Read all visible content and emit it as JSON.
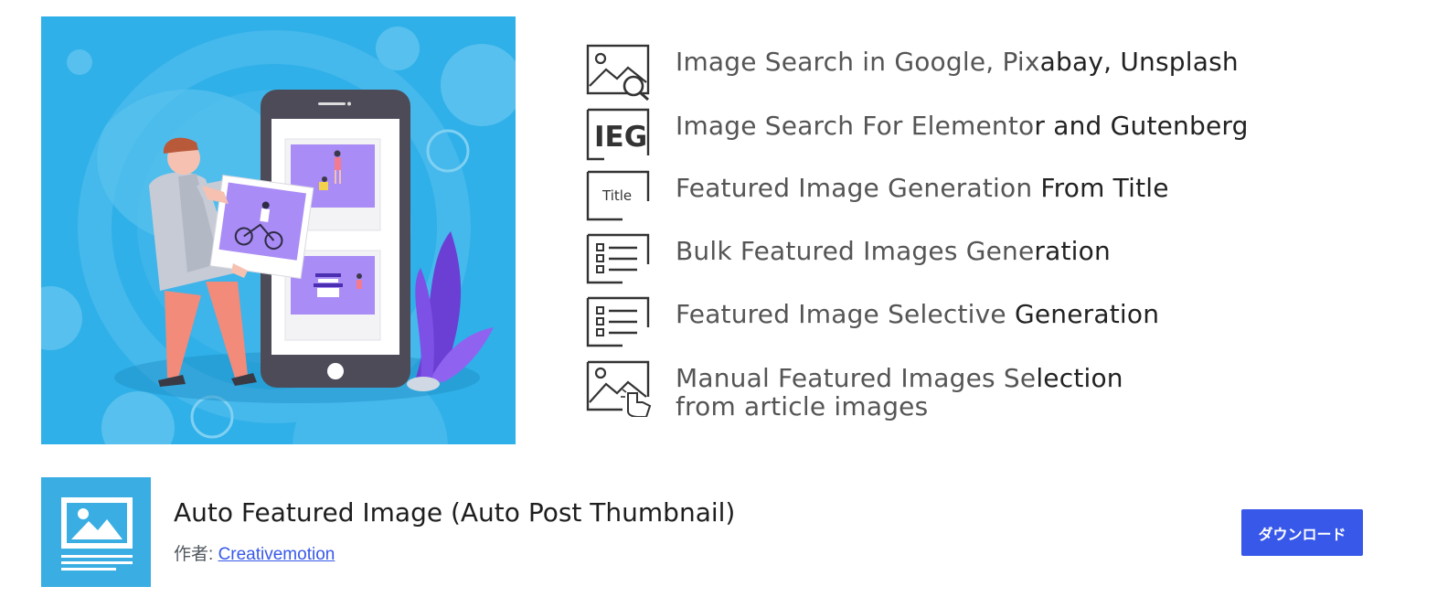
{
  "banner": {
    "features": [
      {
        "icon": "image-search-icon",
        "text_light": "Image Search in Google, Pix",
        "text_dark": "abay, Unsplash"
      },
      {
        "icon": "elementor-gutenberg-icon",
        "icon_text": "IEG",
        "text_light": "Image Search For Elemento",
        "text_dark": "r and Gutenberg"
      },
      {
        "icon": "title-icon",
        "icon_text": "Title",
        "text_light": "Featured Image Generation ",
        "text_dark": "From Title"
      },
      {
        "icon": "checklist-icon",
        "text_light": "Bulk Featured Images Gene",
        "text_dark": "ration"
      },
      {
        "icon": "checklist-icon",
        "text_light": "Featured Image Selective ",
        "text_dark": "Generation"
      },
      {
        "icon": "image-pointer-icon",
        "text_light": "Manual Featured Images Se",
        "text_dark": "lection",
        "line2": "from article images"
      }
    ]
  },
  "plugin": {
    "title": "Auto Featured Image (Auto Post Thumbnail)",
    "author_prefix": "作者: ",
    "author_name": "Creativemotion",
    "download_label": "ダウンロード"
  },
  "colors": {
    "banner_blue": "#2fb0e8",
    "accent_purple": "#a98cf5",
    "button_blue": "#3858e9",
    "icon_blue": "#3aaee3"
  }
}
